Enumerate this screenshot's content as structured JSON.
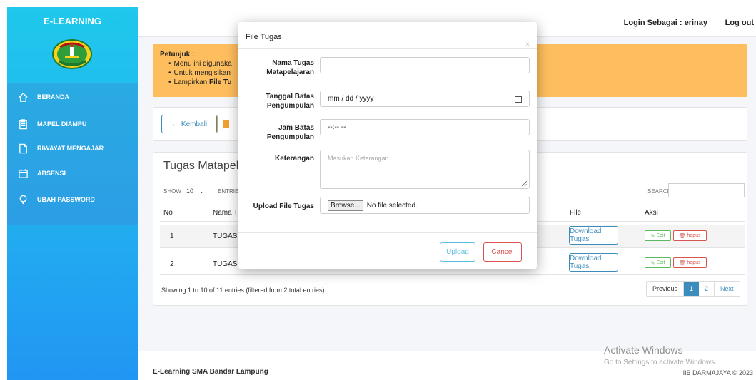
{
  "sidebar": {
    "brand": "E-LEARNING",
    "items": [
      {
        "label": "BERANDA",
        "icon": "home-icon"
      },
      {
        "label": "MAPEL DIAMPU",
        "icon": "clipboard-icon"
      },
      {
        "label": "RIWAYAT MENGAJAR",
        "icon": "file-icon"
      },
      {
        "label": "ABSENSI",
        "icon": "calendar-icon"
      },
      {
        "label": "UBAH PASSWORD",
        "icon": "key-icon"
      }
    ]
  },
  "topbar": {
    "login_as": "Login Sebagai : erinay",
    "logout": "Log out"
  },
  "callout": {
    "heading": "Petunjuk :",
    "items": [
      "Menu ini digunaka",
      "Untuk mengisikan",
      "Lampirkan"
    ],
    "bold_word": "File Tu"
  },
  "actions": {
    "back_label": "Kembali"
  },
  "table_card": {
    "title": "Tugas Matapela",
    "show_label": "SHOW",
    "entries_value": "10",
    "entries_label": "ENTRIES",
    "search_label": "SEARCH:",
    "headers": {
      "no": "No",
      "name": "Nama T",
      "file": "File",
      "aksi": "Aksi"
    },
    "rows": [
      {
        "no": "1",
        "name": "TUGAS",
        "download": "Download Tugas",
        "edit": "Edit",
        "hapus": "hapus"
      },
      {
        "no": "2",
        "name": "TUGAS",
        "download": "Download Tugas",
        "edit": "Edit",
        "hapus": "hapus"
      }
    ],
    "showing": "Showing 1 to 10 of 11 entries (filtered from 2 total entries)",
    "pagination": {
      "previous": "Previous",
      "pages": [
        "1",
        "2"
      ],
      "next": "Next",
      "active": "1"
    }
  },
  "footer": {
    "left": "E-Learning SMA Bandar Lampung",
    "right": "IIB DARMAJAYA © 2023"
  },
  "watermark": {
    "line1": "Activate Windows",
    "line2": "Go to Settings to activate Windows."
  },
  "modal": {
    "title": "File Tugas",
    "close": "×",
    "fields": {
      "nama_label": "Nama Tugas Matapelajaran",
      "nama_value": "",
      "tanggal_label": "Tanggal Batas Pengumpulan",
      "tanggal_value": "mm / dd / yyyy",
      "jam_label": "Jam Batas Pengumpulan",
      "jam_value": "--:-- --",
      "ket_label": "Keterangan",
      "ket_placeholder": "Masukan Keterangan",
      "upload_label": "Upload File Tugas",
      "browse_label": "Browse...",
      "file_status": "No file selected."
    },
    "upload_button": "Upload",
    "cancel_button": "Cancel"
  },
  "colors": {
    "sidebar_top": "#1fc8ec",
    "sidebar_bottom": "#2196f3",
    "callout": "#ffbe5e",
    "primary": "#3c8dbc",
    "success": "#5cb85c",
    "danger": "#d9534f",
    "info": "#5bc0de"
  }
}
